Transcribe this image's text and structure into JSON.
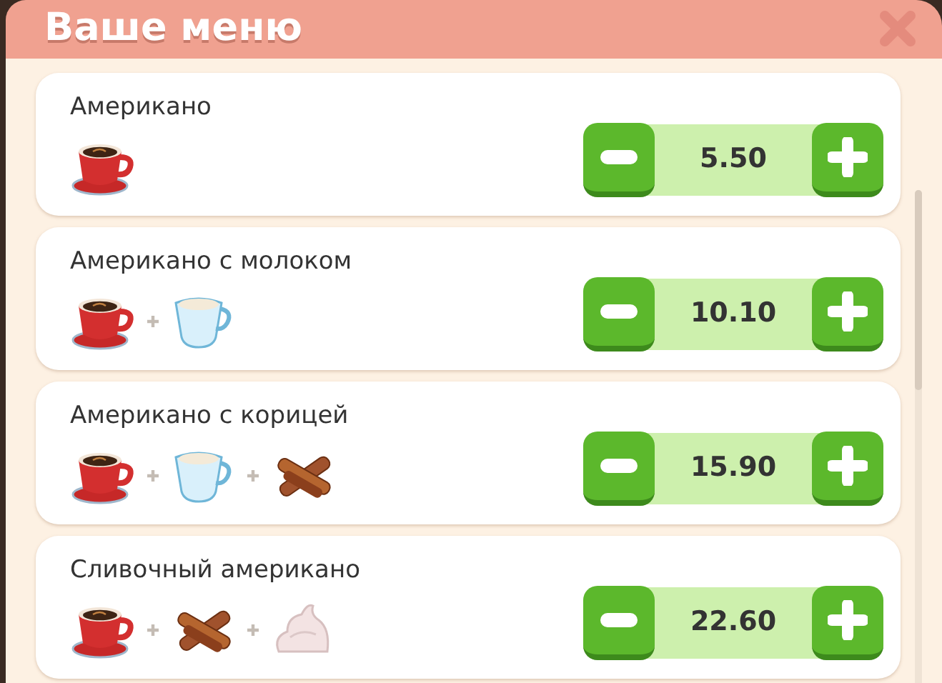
{
  "window": {
    "title": "Ваше меню"
  },
  "items": [
    {
      "name": "Американо",
      "ingredients": [
        {
          "kind": "coffee"
        }
      ],
      "value": "5.50"
    },
    {
      "name": "Американо с молоком",
      "ingredients": [
        {
          "kind": "coffee"
        },
        {
          "kind": "milk"
        }
      ],
      "value": "10.10"
    },
    {
      "name": "Американо с корицей",
      "ingredients": [
        {
          "kind": "coffee"
        },
        {
          "kind": "milk"
        },
        {
          "kind": "cinnamon"
        }
      ],
      "value": "15.90"
    },
    {
      "name": "Сливочный американо",
      "ingredients": [
        {
          "kind": "coffee"
        },
        {
          "kind": "cinnamon"
        },
        {
          "kind": "cream"
        }
      ],
      "value": "22.60"
    }
  ]
}
